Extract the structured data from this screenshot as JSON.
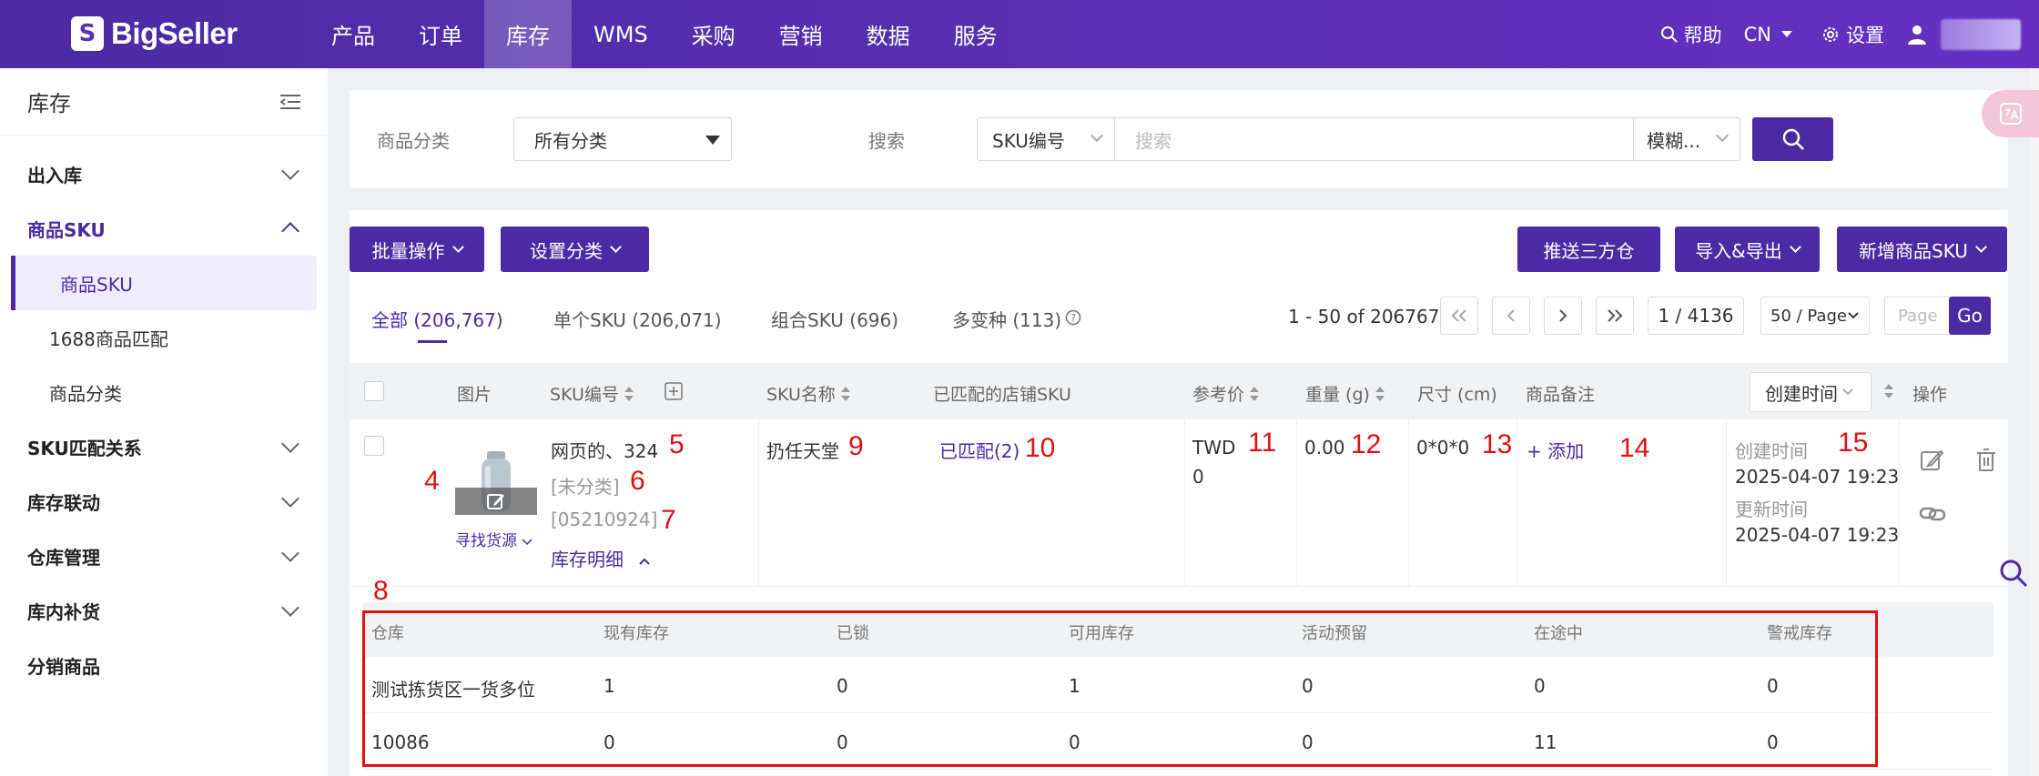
{
  "brand": {
    "name": "BigSeller"
  },
  "topnav": {
    "items": [
      "产品",
      "订单",
      "库存",
      "WMS",
      "采购",
      "营销",
      "数据",
      "服务"
    ],
    "active_index": 2,
    "help": "帮助",
    "lang": "CN",
    "settings": "设置"
  },
  "sidebar": {
    "title": "库存",
    "groups": [
      {
        "label": "出入库"
      },
      {
        "label": "商品SKU",
        "open": true
      },
      {
        "label": "SKU匹配关系"
      },
      {
        "label": "库存联动"
      },
      {
        "label": "仓库管理"
      },
      {
        "label": "库内补货"
      },
      {
        "label": "分销商品"
      }
    ],
    "subitems": [
      "商品SKU",
      "1688商品匹配",
      "商品分类"
    ],
    "active_sub": "商品SKU"
  },
  "filter": {
    "category_label": "商品分类",
    "category_value": "所有分类",
    "search_label": "搜索",
    "search_field": "SKU编号",
    "search_placeholder": "搜索",
    "match_mode": "模糊..."
  },
  "toolbar": {
    "bulk": "批量操作",
    "set_category": "设置分类",
    "push_3pl": "推送三方仓",
    "import_export": "导入&导出",
    "add_sku": "新增商品SKU"
  },
  "tabs": [
    "全部 (206,767)",
    "单个SKU (206,071)",
    "组合SKU (696)",
    "多变种 (113)"
  ],
  "pagination": {
    "range": "1 - 50 of 206767",
    "page": "1 / 4136",
    "per_page": "50 / Page",
    "page_placeholder": "Page",
    "go": "Go"
  },
  "table": {
    "headers": {
      "image": "图片",
      "sku_code": "SKU编号",
      "sku_name": "SKU名称",
      "matched_store_sku": "已匹配的店铺SKU",
      "ref_price": "参考价",
      "weight": "重量 (g)",
      "size": "尺寸 (cm)",
      "remark": "商品备注",
      "created_time_sort": "创建时间",
      "actions": "操作"
    },
    "row": {
      "sku_code": "网页的、324",
      "category": "[未分类]",
      "code_bracket": "[05210924]",
      "inventory_detail": "库存明细",
      "find_source": "寻找货源",
      "sku_name": "扔任天堂",
      "matched": "已匹配(2)",
      "price_currency": "TWD",
      "price_value": "0",
      "weight": "0.00",
      "size": "0*0*0",
      "remark_add": "+ 添加",
      "created_label": "创建时间",
      "created_at": "2025-04-07 19:23",
      "updated_label": "更新时间",
      "updated_at": "2025-04-07 19:23"
    }
  },
  "inventory": {
    "headers": [
      "仓库",
      "现有库存",
      "已锁",
      "可用库存",
      "活动预留",
      "在途中",
      "警戒库存"
    ],
    "rows": [
      [
        "测试拣货区一货多位",
        "1",
        "0",
        "1",
        "0",
        "0",
        "0"
      ],
      [
        "10086",
        "0",
        "0",
        "0",
        "0",
        "11",
        "0"
      ]
    ]
  },
  "annotations": [
    "4",
    "5",
    "6",
    "7",
    "8",
    "9",
    "10",
    "11",
    "12",
    "13",
    "14",
    "15"
  ],
  "colors": {
    "brand": "#4b2aa3",
    "annotation": "#e01010"
  }
}
